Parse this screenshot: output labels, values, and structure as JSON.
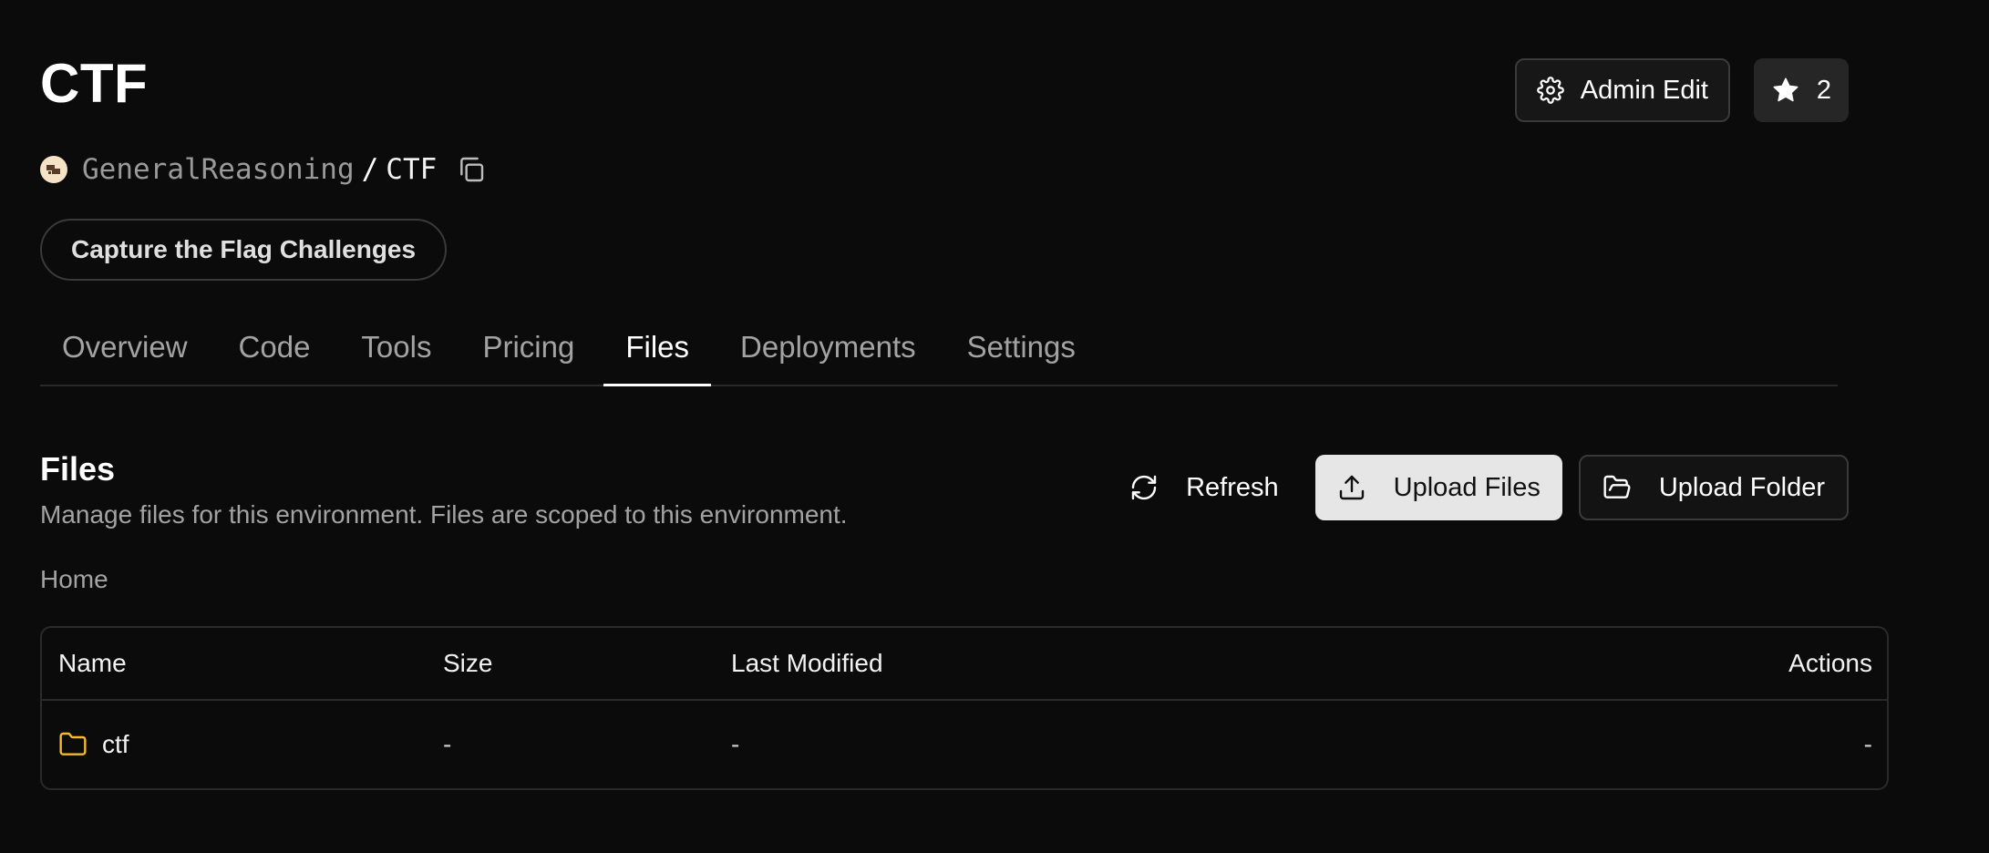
{
  "repo": {
    "title": "CTF",
    "org": "GeneralReasoning",
    "separator": "/",
    "name": "CTF",
    "description": "Capture the Flag Challenges"
  },
  "header_actions": {
    "admin_edit_label": "Admin Edit",
    "star_count": "2"
  },
  "tabs": [
    {
      "label": "Overview",
      "active": false
    },
    {
      "label": "Code",
      "active": false
    },
    {
      "label": "Tools",
      "active": false
    },
    {
      "label": "Pricing",
      "active": false
    },
    {
      "label": "Files",
      "active": true
    },
    {
      "label": "Deployments",
      "active": false
    },
    {
      "label": "Settings",
      "active": false
    }
  ],
  "files": {
    "title": "Files",
    "subtitle": "Manage files for this environment. Files are scoped to this environment.",
    "breadcrumb": "Home",
    "toolbar": {
      "refresh_label": "Refresh",
      "upload_files_label": "Upload Files",
      "upload_folder_label": "Upload Folder"
    },
    "columns": {
      "name": "Name",
      "size": "Size",
      "last_modified": "Last Modified",
      "actions": "Actions"
    },
    "rows": [
      {
        "icon": "folder-icon",
        "name": "ctf",
        "size": "-",
        "last_modified": "-",
        "actions": "-"
      }
    ]
  },
  "colors": {
    "background": "#0b0b0b",
    "folder_icon": "#f5b82e",
    "active_tab": "#ffffff",
    "muted_text": "#a3a3a3"
  }
}
